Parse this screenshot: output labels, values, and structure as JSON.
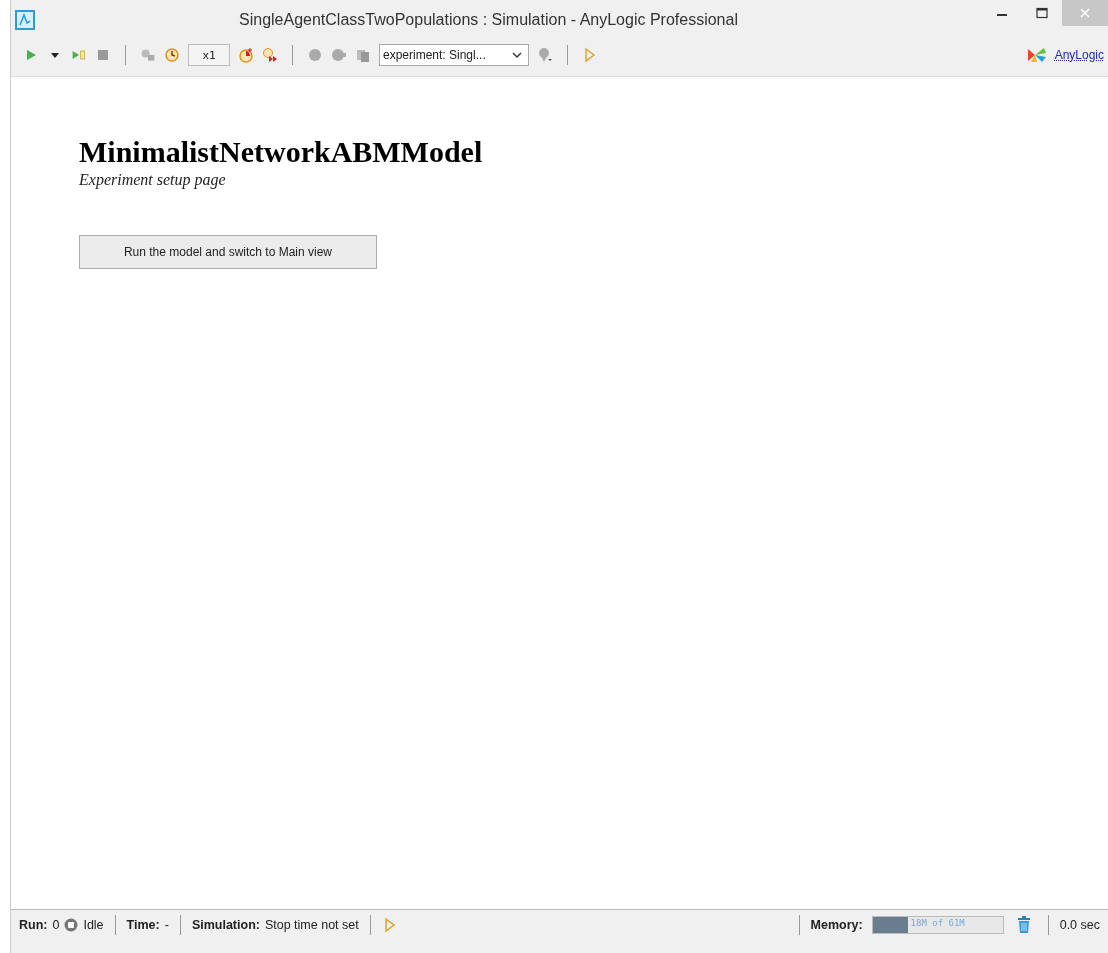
{
  "window": {
    "title": "SingleAgentClassTwoPopulations : Simulation - AnyLogic Professional"
  },
  "toolbar": {
    "speed": "x1",
    "experiment": "experiment: Singl...",
    "logo_link": "AnyLogic"
  },
  "page": {
    "title": "MinimalistNetworkABMModel",
    "subtitle": "Experiment setup page",
    "button": "Run the model and switch to Main view"
  },
  "status_bar": {
    "run_label": "Run:",
    "run_value": "0",
    "state": "Idle",
    "time_label": "Time:",
    "time_value": "-",
    "simulation_label": "Simulation:",
    "simulation_value": "Stop time not set",
    "memory_label": "Memory:",
    "memory": {
      "text": "18M of 61M",
      "level": 0.27
    },
    "elapsed": "0.0 sec"
  }
}
